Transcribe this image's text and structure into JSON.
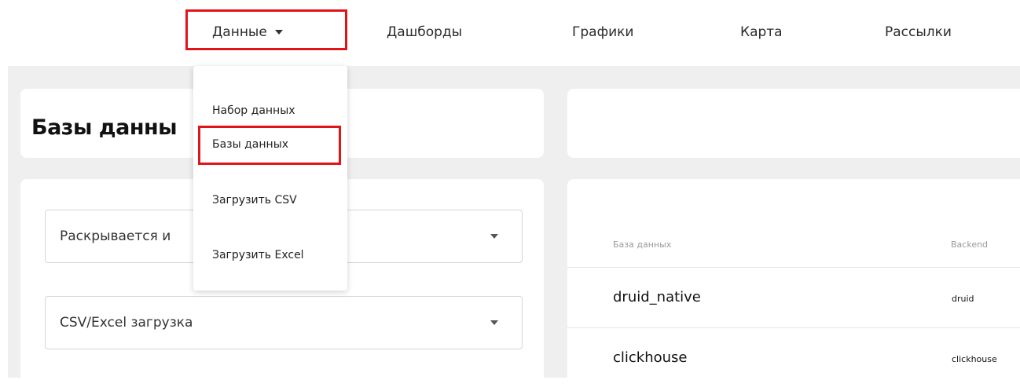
{
  "nav": {
    "data": "Данные",
    "dashboards": "Дашборды",
    "charts": "Графики",
    "map": "Карта",
    "mailings": "Рассылки"
  },
  "dropdown": {
    "items": [
      {
        "label": "Набор данных"
      },
      {
        "label": "Базы данных"
      },
      {
        "label": "Загрузить CSV"
      },
      {
        "label": "Загрузить Excel"
      }
    ]
  },
  "page": {
    "title": "Базы данны"
  },
  "filters": {
    "first_select": "Раскрывается и",
    "second_select": "CSV/Excel загрузка"
  },
  "table": {
    "headers": {
      "database": "База данных",
      "backend": "Backend"
    },
    "rows": [
      {
        "name": "druid_native",
        "backend": "druid"
      },
      {
        "name": "clickhouse",
        "backend": "clickhouse"
      }
    ]
  },
  "colors": {
    "highlight": "#e1141b",
    "content_background": "#efefef"
  }
}
